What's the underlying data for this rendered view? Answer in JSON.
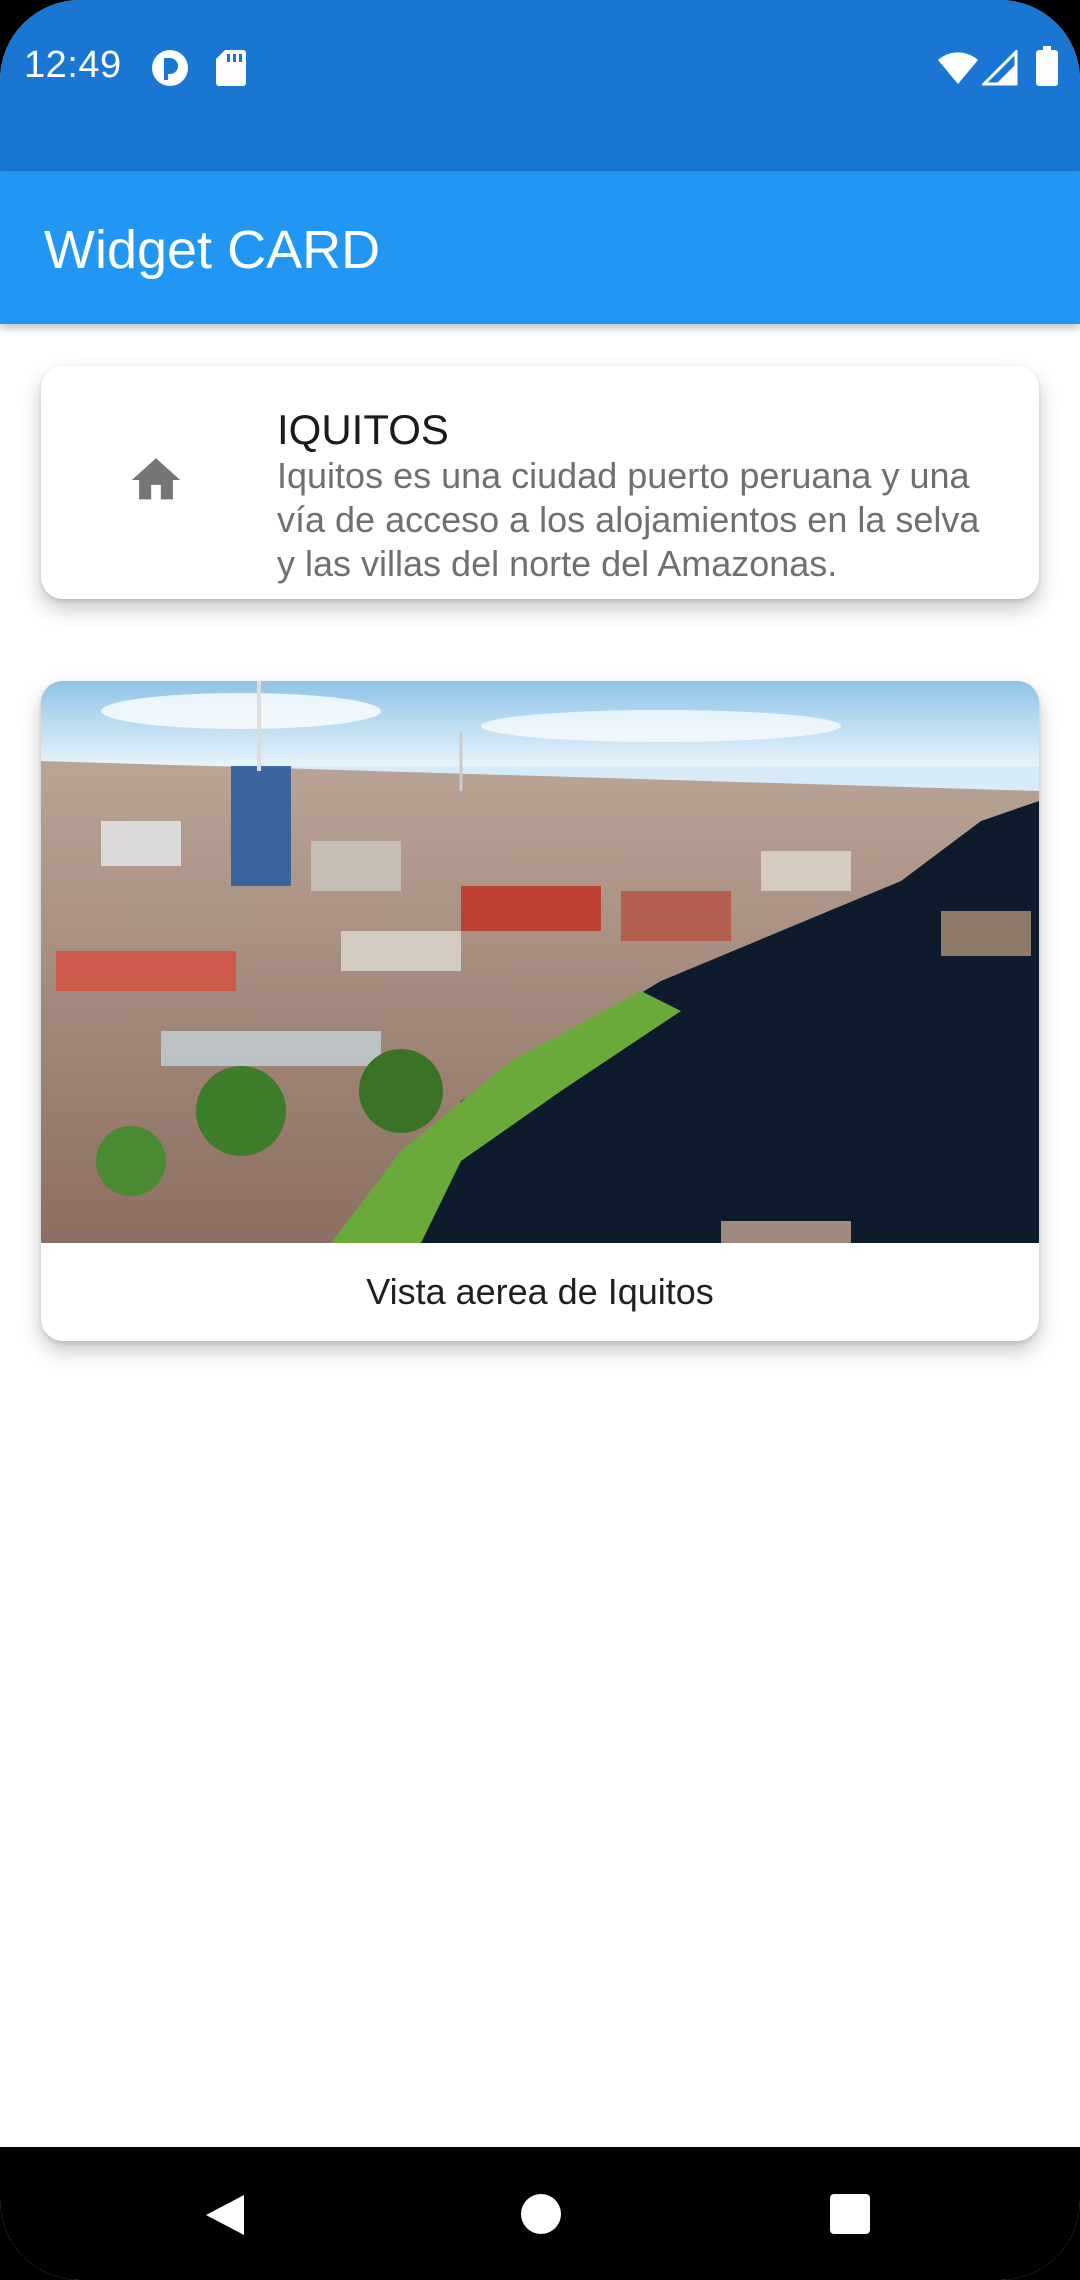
{
  "status_bar": {
    "time": "12:49",
    "icons": [
      "data-saver-icon",
      "sd-card-icon",
      "wifi-icon",
      "cell-signal-icon",
      "battery-icon"
    ]
  },
  "app_bar": {
    "title": "Widget CARD"
  },
  "list_card": {
    "icon": "home-icon",
    "title": "IQUITOS",
    "subtitle": "Iquitos es una ciudad puerto peruana y una vía de acceso a los alojamientos en la selva y las villas del norte del Amazonas."
  },
  "image_card": {
    "image": "aerial-photo-of-iquitos-riverfront",
    "caption": "Vista aerea de Iquitos"
  },
  "nav_bar": {
    "buttons": [
      "back-icon",
      "home-circle-icon",
      "recents-square-icon"
    ]
  },
  "colors": {
    "status_bar": "#1976d2",
    "app_bar": "#2196f3",
    "icon_gray": "#757575"
  }
}
